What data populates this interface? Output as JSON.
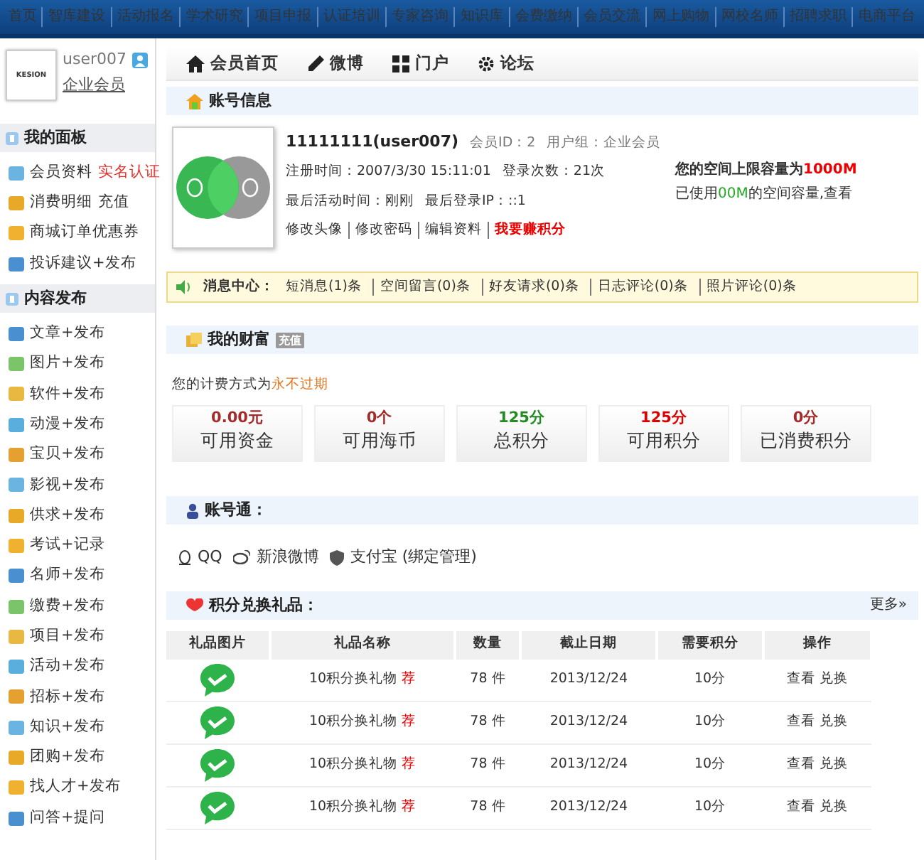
{
  "top_nav": [
    "首页",
    "智库建设",
    "活动报名",
    "学术研究",
    "项目申报",
    "认证培训",
    "专家咨询",
    "知识库",
    "会费缴纳",
    "会员交流",
    "网上购物",
    "网校名师",
    "招聘求职",
    "电商平台"
  ],
  "user": {
    "logo": "KESION",
    "username": "user007",
    "group": "企业会员"
  },
  "sidebar": [
    {
      "title": "我的面板",
      "items": [
        {
          "label": "会员资料",
          "extra": "实名认证",
          "extra_red": true
        },
        {
          "label": "消费明细",
          "extra": "充值",
          "extra_red": false
        },
        {
          "label": "商城订单优惠券"
        },
        {
          "label": "投诉建议+发布"
        }
      ]
    },
    {
      "title": "内容发布",
      "items": [
        {
          "label": "文章+发布"
        },
        {
          "label": "图片+发布"
        },
        {
          "label": "软件+发布"
        },
        {
          "label": "动漫+发布"
        },
        {
          "label": "宝贝+发布"
        },
        {
          "label": "影视+发布"
        },
        {
          "label": "供求+发布"
        },
        {
          "label": "考试+记录"
        },
        {
          "label": "名师+发布"
        },
        {
          "label": "缴费+发布"
        },
        {
          "label": "项目+发布"
        },
        {
          "label": "活动+发布"
        },
        {
          "label": "招标+发布"
        },
        {
          "label": "知识+发布"
        },
        {
          "label": "团购+发布"
        },
        {
          "label": "找人才+发布"
        },
        {
          "label": "问答+提问"
        }
      ]
    }
  ],
  "tabs": [
    {
      "label": "会员首页",
      "kind": "home"
    },
    {
      "label": "微博",
      "kind": "pen"
    },
    {
      "label": "门户",
      "kind": "grid"
    },
    {
      "label": "论坛",
      "kind": "gear"
    }
  ],
  "account": {
    "title": "账号信息",
    "name": "11111111(user007)",
    "member_id": "会员ID：2",
    "group": "用户组：企业会员",
    "registered": "注册时间：2007/3/30 15:11:01",
    "logins": "登录次数：21次",
    "last_active": "最后活动时间：刚刚",
    "last_ip": "最后登录IP：::1",
    "links": [
      {
        "label": "修改头像",
        "highlight": false
      },
      {
        "label": "修改密码",
        "highlight": false
      },
      {
        "label": "编辑资料",
        "highlight": false
      },
      {
        "label": "我要赚积分",
        "highlight": true
      }
    ],
    "quota_prefix": "您的空间上限容量为",
    "quota_value": "1000M",
    "used_prefix": "已使用",
    "used_value": "00M",
    "used_suffix": "的空间容量,查看"
  },
  "messages": {
    "label": "消息中心：",
    "items": [
      "短消息(1)条",
      "空间留言(0)条",
      "好友请求(0)条",
      "日志评论(0)条",
      "照片评论(0)条"
    ]
  },
  "wealth": {
    "title": "我的财富",
    "badge": "充值",
    "billing_prefix": "您的计费方式为",
    "billing_value": "永不过期",
    "stats": [
      {
        "value": "0.00元",
        "label": "可用资金",
        "color": "#a52a2a"
      },
      {
        "value": "0个",
        "label": "可用海币",
        "color": "#a52a2a"
      },
      {
        "value": "125分",
        "label": "总积分",
        "color": "#228b22"
      },
      {
        "value": "125分",
        "label": "可用积分",
        "color": "#dd0000"
      },
      {
        "value": "0分",
        "label": "已消费积分",
        "color": "#a52a2a"
      }
    ]
  },
  "binding": {
    "title": "账号通：",
    "links": [
      {
        "label": "QQ",
        "kind": "qq"
      },
      {
        "label": "新浪微博",
        "kind": "weibo"
      },
      {
        "label": "支付宝 (绑定管理)",
        "kind": "shield"
      }
    ]
  },
  "gifts": {
    "title": "积分兑换礼品：",
    "more": "更多»",
    "columns": [
      "礼品图片",
      "礼品名称",
      "数量",
      "截止日期",
      "需要积分",
      "操作"
    ],
    "rows": [
      {
        "name": "10积分换礼物",
        "tag": "荐",
        "qty": "78 件",
        "date": "2013/12/24",
        "points": "10分",
        "actions": [
          "查看",
          "兑换"
        ]
      },
      {
        "name": "10积分换礼物",
        "tag": "荐",
        "qty": "78 件",
        "date": "2013/12/24",
        "points": "10分",
        "actions": [
          "查看",
          "兑换"
        ]
      },
      {
        "name": "10积分换礼物",
        "tag": "荐",
        "qty": "78 件",
        "date": "2013/12/24",
        "points": "10分",
        "actions": [
          "查看",
          "兑换"
        ]
      },
      {
        "name": "10积分换礼物",
        "tag": "荐",
        "qty": "78 件",
        "date": "2013/12/24",
        "points": "10分",
        "actions": [
          "查看",
          "兑换"
        ]
      }
    ]
  }
}
